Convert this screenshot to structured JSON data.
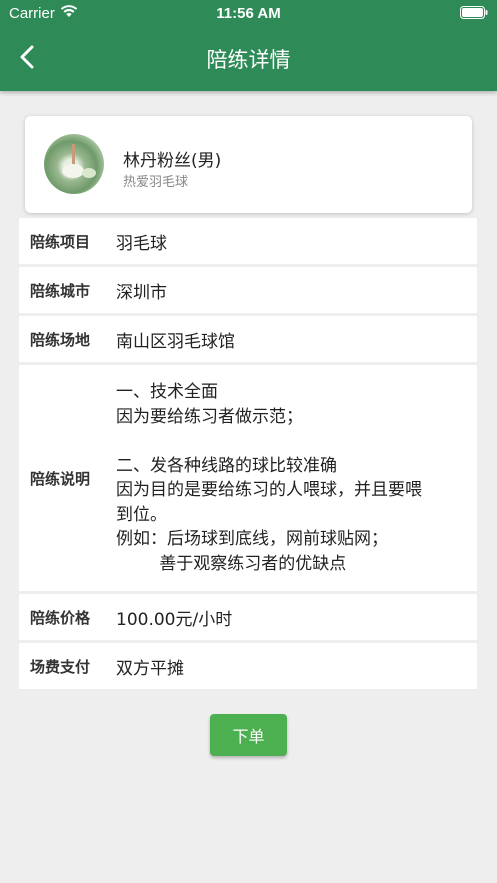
{
  "status_bar": {
    "carrier": "Carrier",
    "time": "11:56 AM"
  },
  "header": {
    "title": "陪练详情",
    "back_icon": "chevron-left-icon"
  },
  "profile": {
    "name": "林丹粉丝(男)",
    "subtitle": "热爱羽毛球"
  },
  "details": {
    "project": {
      "label": "陪练项目",
      "value": "羽毛球"
    },
    "city": {
      "label": "陪练城市",
      "value": "深圳市"
    },
    "venue": {
      "label": "陪练场地",
      "value": "南山区羽毛球馆"
    },
    "description": {
      "label": "陪练说明",
      "lines": [
        "一、技术全面",
        "因为要给练习者做示范；",
        "",
        "二、发各种线路的球比较准确",
        "因为目的是要给练习的人喂球，并且要喂",
        "到位。",
        "例如：后场球到底线，网前球贴网；",
        "        善于观察练习者的优缺点"
      ]
    },
    "price": {
      "label": "陪练价格",
      "value": "100.00元/小时"
    },
    "fee": {
      "label": "场费支付",
      "value": "双方平摊"
    }
  },
  "order_button": {
    "label": "下单"
  },
  "colors": {
    "header": "#2e8b57",
    "button": "#4caf50",
    "background": "#eeeeee"
  }
}
